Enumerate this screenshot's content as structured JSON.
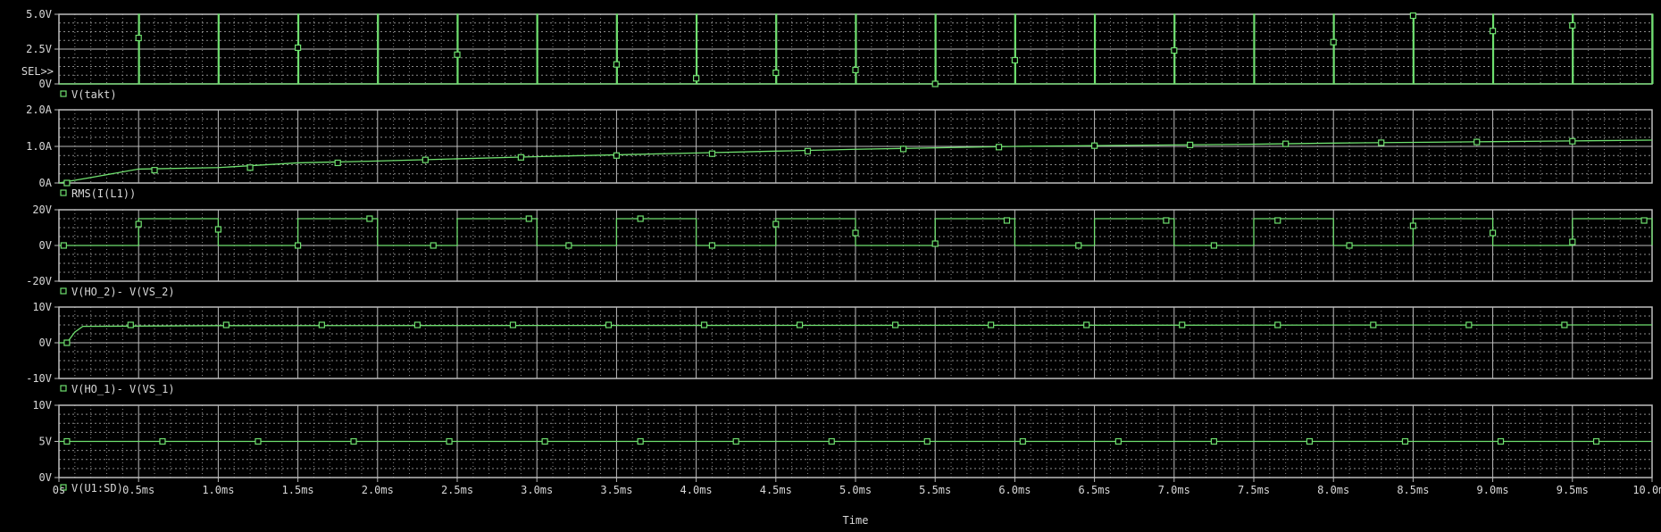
{
  "colors": {
    "background": "#000000",
    "grid_major": "#bdbdbd",
    "grid_minor": "#8a8a8a",
    "trace": "#6fe06f",
    "label": "#d8d8d8"
  },
  "x_axis": {
    "label": "Time",
    "ticks": [
      "0s",
      "0.5ms",
      "1.0ms",
      "1.5ms",
      "2.0ms",
      "2.5ms",
      "3.0ms",
      "3.5ms",
      "4.0ms",
      "4.5ms",
      "5.0ms",
      "5.5ms",
      "6.0ms",
      "6.5ms",
      "7.0ms",
      "7.5ms",
      "8.0ms",
      "8.5ms",
      "9.0ms",
      "9.5ms",
      "10.0ms"
    ],
    "range_ms": [
      0,
      10
    ]
  },
  "selection_marker": "SEL>>",
  "chart_data": [
    {
      "type": "line",
      "legend": "V(takt)",
      "y_ticks": [
        "5.0V",
        "2.5V",
        "0V"
      ],
      "ylim": [
        0,
        5
      ],
      "grid": true,
      "kind": "pulses",
      "period_ms": 0.5,
      "pulse_width_ms": 0.005,
      "high": 5,
      "low": 0,
      "markers": [
        [
          0.5,
          3.3
        ],
        [
          1.5,
          2.6
        ],
        [
          2.5,
          2.1
        ],
        [
          3.5,
          1.4
        ],
        [
          4.0,
          0.4
        ],
        [
          4.5,
          0.8
        ],
        [
          5.0,
          1.0
        ],
        [
          5.5,
          0.0
        ],
        [
          6.0,
          1.7
        ],
        [
          7.0,
          2.4
        ],
        [
          8.0,
          3.0
        ],
        [
          8.5,
          4.9
        ],
        [
          9.0,
          3.8
        ],
        [
          9.5,
          4.2
        ]
      ]
    },
    {
      "type": "line",
      "legend": "RMS(I(L1))",
      "y_ticks": [
        "2.0A",
        "1.0A",
        "0A"
      ],
      "ylim": [
        0,
        2
      ],
      "grid": true,
      "kind": "line",
      "x": [
        0,
        0.2,
        0.5,
        1.0,
        1.5,
        2.0,
        2.5,
        3.0,
        3.5,
        4.0,
        4.5,
        5.0,
        5.5,
        6.0,
        6.5,
        7.0,
        7.5,
        8.0,
        8.5,
        9.0,
        9.5,
        10.0
      ],
      "y": [
        0,
        0.15,
        0.38,
        0.42,
        0.55,
        0.6,
        0.66,
        0.72,
        0.77,
        0.82,
        0.87,
        0.92,
        0.96,
        1.0,
        1.02,
        1.04,
        1.06,
        1.09,
        1.11,
        1.13,
        1.15,
        1.17
      ],
      "markers": [
        [
          0.05,
          0.0
        ],
        [
          0.6,
          0.35
        ],
        [
          1.2,
          0.42
        ],
        [
          1.75,
          0.55
        ],
        [
          2.3,
          0.63
        ],
        [
          2.9,
          0.7
        ],
        [
          3.5,
          0.75
        ],
        [
          4.1,
          0.8
        ],
        [
          4.7,
          0.87
        ],
        [
          5.3,
          0.93
        ],
        [
          5.9,
          0.98
        ],
        [
          6.5,
          1.02
        ],
        [
          7.1,
          1.04
        ],
        [
          7.7,
          1.07
        ],
        [
          8.3,
          1.1
        ],
        [
          8.9,
          1.12
        ],
        [
          9.5,
          1.14
        ]
      ]
    },
    {
      "type": "line",
      "legend": "V(HO_2)- V(VS_2)",
      "y_ticks": [
        "20V",
        "0V",
        "-20V"
      ],
      "ylim": [
        -20,
        20
      ],
      "grid": true,
      "kind": "square",
      "high_intervals": [
        [
          0.5,
          1.0
        ],
        [
          1.5,
          2.0
        ],
        [
          2.5,
          3.0
        ],
        [
          3.5,
          4.0
        ],
        [
          4.5,
          5.0
        ],
        [
          5.5,
          6.0
        ],
        [
          6.5,
          7.0
        ],
        [
          7.5,
          8.0
        ],
        [
          8.5,
          9.0
        ],
        [
          9.5,
          10.0
        ]
      ],
      "high": 15,
      "low": 0,
      "markers": [
        [
          0.03,
          0
        ],
        [
          0.5,
          12
        ],
        [
          1.0,
          9
        ],
        [
          1.5,
          0
        ],
        [
          1.95,
          15
        ],
        [
          2.35,
          0
        ],
        [
          2.95,
          15
        ],
        [
          3.2,
          0
        ],
        [
          3.65,
          15
        ],
        [
          4.1,
          0
        ],
        [
          4.5,
          12
        ],
        [
          5.0,
          7
        ],
        [
          5.5,
          1
        ],
        [
          5.95,
          14
        ],
        [
          6.4,
          0
        ],
        [
          6.95,
          14
        ],
        [
          7.25,
          0
        ],
        [
          7.65,
          14
        ],
        [
          8.1,
          0
        ],
        [
          8.5,
          11
        ],
        [
          9.0,
          7
        ],
        [
          9.5,
          2
        ],
        [
          9.95,
          14
        ]
      ]
    },
    {
      "type": "line",
      "legend": "V(HO_1)- V(VS_1)",
      "y_ticks": [
        "10V",
        "0V",
        "-10V"
      ],
      "ylim": [
        -10,
        10
      ],
      "grid": true,
      "kind": "line",
      "x": [
        0,
        0.05,
        0.1,
        0.15,
        1.0,
        10.0
      ],
      "y": [
        0,
        0,
        3,
        4.6,
        4.8,
        5.0
      ],
      "markers": [
        [
          0.05,
          0
        ],
        [
          0.45,
          5
        ],
        [
          1.05,
          5
        ],
        [
          1.65,
          5
        ],
        [
          2.25,
          5
        ],
        [
          2.85,
          5
        ],
        [
          3.45,
          5
        ],
        [
          4.05,
          5
        ],
        [
          4.65,
          5
        ],
        [
          5.25,
          5
        ],
        [
          5.85,
          5
        ],
        [
          6.45,
          5
        ],
        [
          7.05,
          5
        ],
        [
          7.65,
          5
        ],
        [
          8.25,
          5
        ],
        [
          8.85,
          5
        ],
        [
          9.45,
          5
        ]
      ]
    },
    {
      "type": "line",
      "legend": "V(U1:SD)",
      "y_ticks": [
        "10V",
        "5V",
        "0V"
      ],
      "ylim": [
        0,
        10
      ],
      "grid": true,
      "kind": "line",
      "x": [
        0,
        10.0
      ],
      "y": [
        5,
        5
      ],
      "markers": [
        [
          0.05,
          5
        ],
        [
          0.65,
          5
        ],
        [
          1.25,
          5
        ],
        [
          1.85,
          5
        ],
        [
          2.45,
          5
        ],
        [
          3.05,
          5
        ],
        [
          3.65,
          5
        ],
        [
          4.25,
          5
        ],
        [
          4.85,
          5
        ],
        [
          5.45,
          5
        ],
        [
          6.05,
          5
        ],
        [
          6.65,
          5
        ],
        [
          7.25,
          5
        ],
        [
          7.85,
          5
        ],
        [
          8.45,
          5
        ],
        [
          9.05,
          5
        ],
        [
          9.65,
          5
        ]
      ]
    }
  ]
}
